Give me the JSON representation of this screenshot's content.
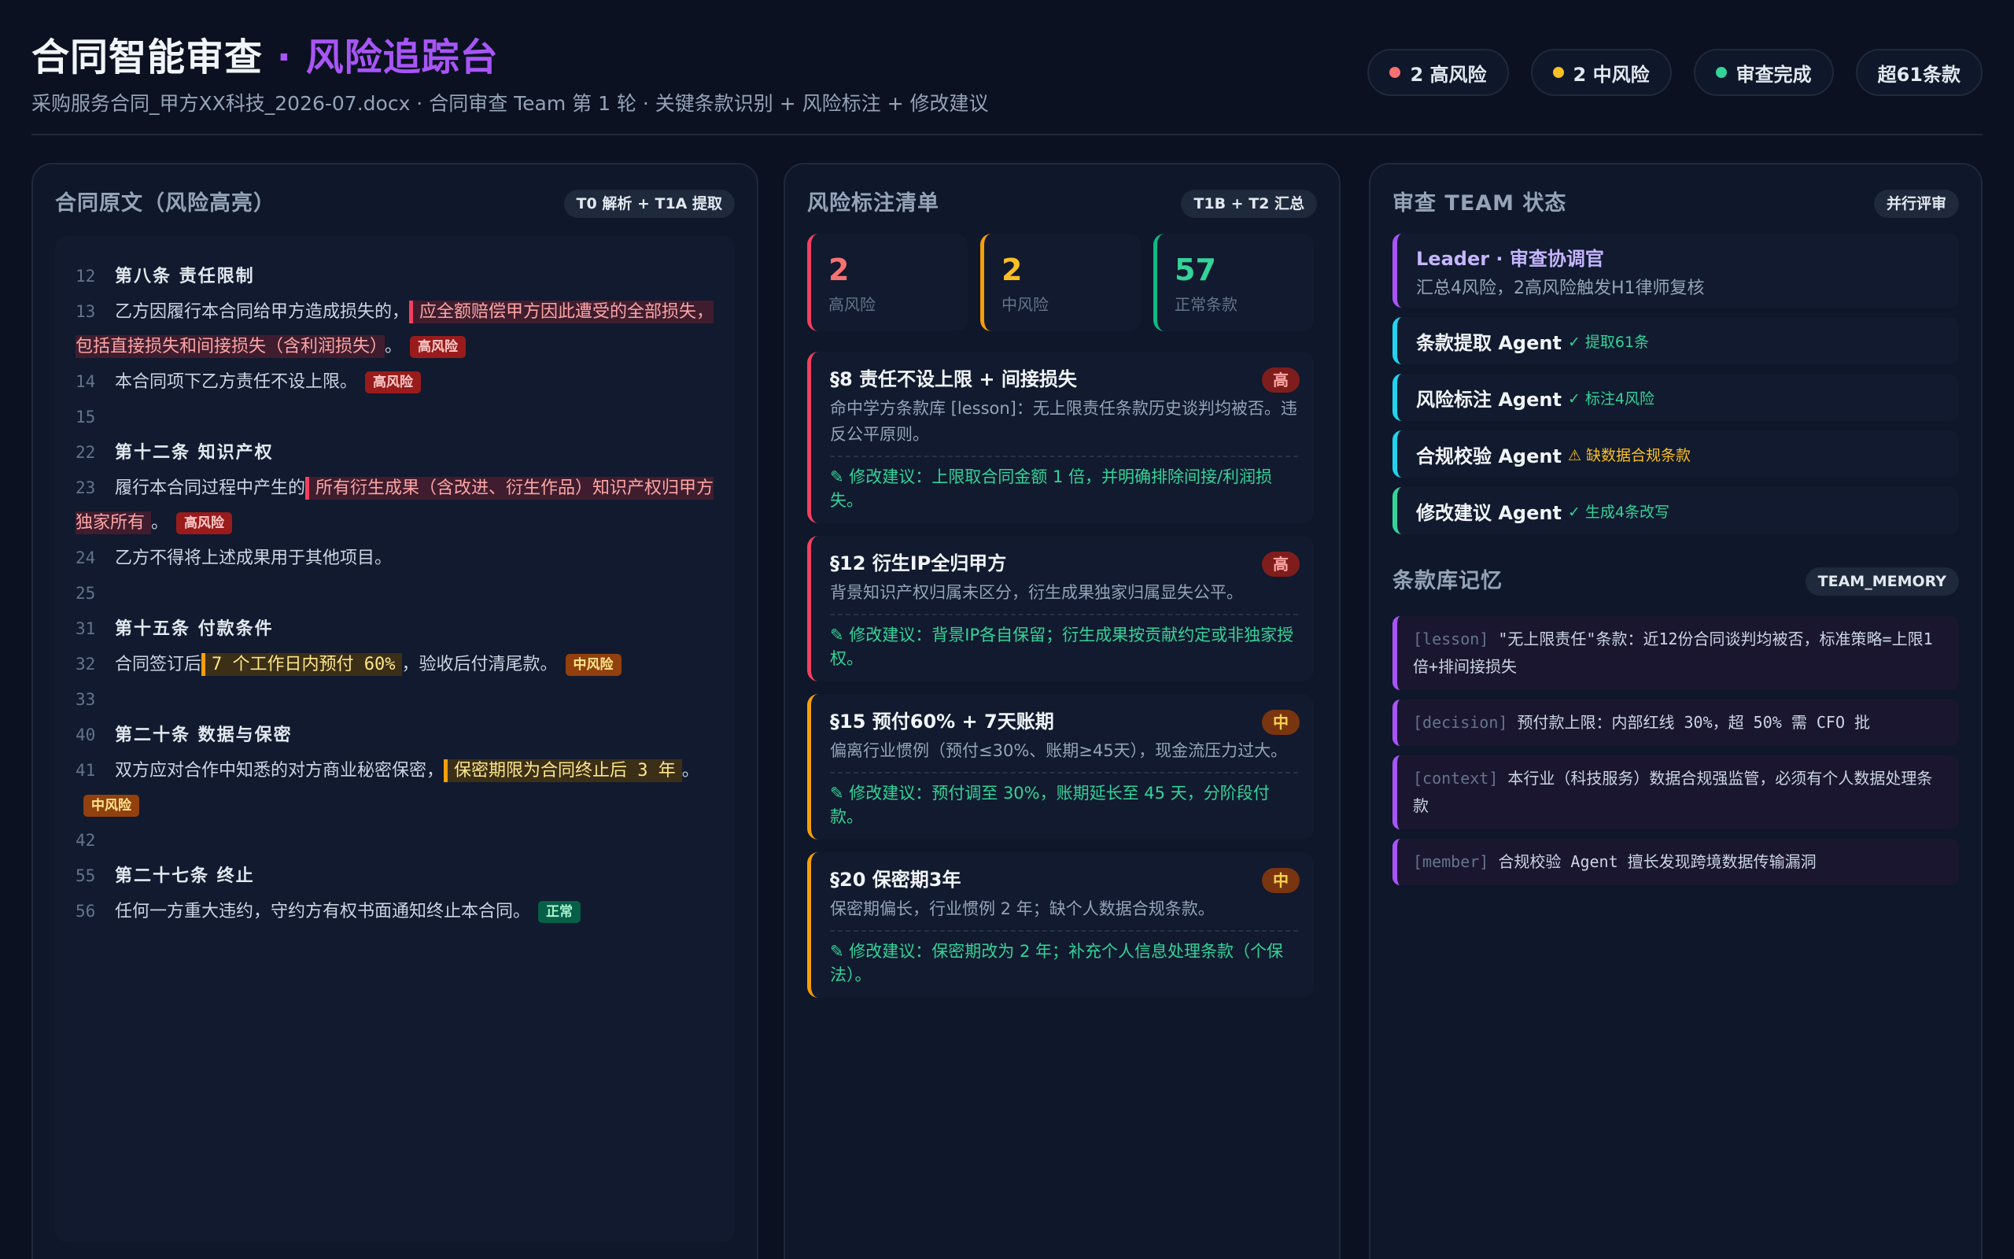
{
  "header": {
    "title_main": "合同智能审查",
    "title_sep": " · ",
    "title_accent": "风险追踪台",
    "subtitle": "采购服务合同_甲方XX科技_2026-07.docx · 合同审查 Team 第 1 轮 · 关键条款识别 + 风险标注 + 修改建议",
    "pills": [
      {
        "label": "2 高风险",
        "dot": "#f87171"
      },
      {
        "label": "2 中风险",
        "dot": "#fbbf24"
      },
      {
        "label": "审查完成",
        "dot": "#34d399"
      },
      {
        "label": "超61条款"
      }
    ]
  },
  "doc_panel": {
    "title": "合同原文（风险高亮）",
    "tag": "T0 解析 + T1A 提取",
    "lines": [
      {
        "num": "12",
        "heading": "第八条  责任限制"
      },
      {
        "num": "13",
        "pre": "乙方因履行本合同给甲方造成损失的，",
        "hl": "应全额赔偿甲方因此遭受的全部损失，包括直接损失和间接损失（含利润损失）",
        "post": "。",
        "badge": "高风险",
        "level": "red"
      },
      {
        "num": "14",
        "pre": "本合同项下乙方责任不设上限。",
        "badge": "高风险",
        "level": "red"
      },
      {
        "num": "15"
      },
      {
        "num": "22",
        "heading": "第十二条  知识产权"
      },
      {
        "num": "23",
        "pre": "履行本合同过程中产生的",
        "hl": "所有衍生成果（含改进、衍生作品）知识产权归甲方独家所有",
        "post": "。",
        "badge": "高风险",
        "level": "red"
      },
      {
        "num": "24",
        "pre": "乙方不得将上述成果用于其他项目。"
      },
      {
        "num": "25"
      },
      {
        "num": "31",
        "heading": "第十五条  付款条件"
      },
      {
        "num": "32",
        "pre": "合同签订后",
        "hl": "7 个工作日内预付 60%",
        "post": "，验收后付清尾款。",
        "badge": "中风险",
        "level": "amber"
      },
      {
        "num": "33"
      },
      {
        "num": "40",
        "heading": "第二十条  数据与保密"
      },
      {
        "num": "41",
        "pre": "双方应对合作中知悉的对方商业秘密保密，",
        "hl": "保密期限为合同终止后 3 年",
        "post": "。",
        "badge": "中风险",
        "level": "amber"
      },
      {
        "num": "42"
      },
      {
        "num": "55",
        "heading": "第二十七条  终止"
      },
      {
        "num": "56",
        "pre": "任何一方重大违约，守约方有权书面通知终止本合同。",
        "badge": "正常",
        "level": "green"
      }
    ]
  },
  "risk_panel": {
    "title": "风险标注清单",
    "tag": "T1B + T2 汇总",
    "stats": [
      {
        "num": "2",
        "label": "高风险",
        "color": "#f87171",
        "border": "#f43f5e"
      },
      {
        "num": "2",
        "label": "中风险",
        "color": "#fbbf24",
        "border": "#f59e0b"
      },
      {
        "num": "57",
        "label": "正常条款",
        "color": "#34d399",
        "border": "#10b981"
      }
    ],
    "cards": [
      {
        "title": "§8 责任不设上限 + 间接损失",
        "level": "高",
        "tone": "red",
        "desc": "命中学方条款库 [lesson]：无上限责任条款历史谈判均被否。违反公平原则。",
        "fix": "✎ 修改建议：上限取合同金额 1 倍，并明确排除间接/利润损失。"
      },
      {
        "title": "§12 衍生IP全归甲方",
        "level": "高",
        "tone": "red",
        "desc": "背景知识产权归属未区分，衍生成果独家归属显失公平。",
        "fix": "✎ 修改建议：背景IP各自保留；衍生成果按贡献约定或非独家授权。"
      },
      {
        "title": "§15 预付60% + 7天账期",
        "level": "中",
        "tone": "amber",
        "desc": "偏离行业惯例（预付≤30%、账期≥45天），现金流压力过大。",
        "fix": "✎ 修改建议：预付调至 30%，账期延长至 45 天，分阶段付款。"
      },
      {
        "title": "§20 保密期3年",
        "level": "中",
        "tone": "amber",
        "desc": "保密期偏长，行业惯例 2 年；缺个人数据合规条款。",
        "fix": "✎ 修改建议：保密期改为 2 年；补充个人信息处理条款（个保法）。"
      }
    ]
  },
  "team_panel": {
    "title": "审查 TEAM 状态",
    "tag": "并行评审",
    "leader": {
      "name": "Leader · 审查协调官",
      "desc": "汇总4风险，2高风险触发H1律师复核"
    },
    "agents": [
      {
        "name": "条款提取 Agent",
        "status": "✓ 提取61条",
        "color": "#22d3ee",
        "status_color": "#34d399"
      },
      {
        "name": "风险标注 Agent",
        "status": "✓ 标注4风险",
        "color": "#22d3ee",
        "status_color": "#34d399"
      },
      {
        "name": "合规校验 Agent",
        "status": "⚠ 缺数据合规条款",
        "color": "#22d3ee",
        "status_color": "#fbbf24"
      },
      {
        "name": "修改建议 Agent",
        "status": "✓ 生成4条改写",
        "color": "#34d399",
        "status_color": "#34d399"
      }
    ],
    "memory_title": "条款库记忆",
    "memory_tag": "TEAM_MEMORY",
    "memories": [
      {
        "tag": "[lesson]",
        "text": "\"无上限责任\"条款：近12份合同谈判均被否，标准策略=上限1倍+排间接损失"
      },
      {
        "tag": "[decision]",
        "text": "预付款上限：内部红线 30%，超 50% 需 CFO 批"
      },
      {
        "tag": "[context]",
        "text": "本行业（科技服务）数据合规强监管，必须有个人数据处理条款"
      },
      {
        "tag": "[member]",
        "text": "合规校验 Agent 擅长发现跨境数据传输漏洞"
      }
    ]
  }
}
